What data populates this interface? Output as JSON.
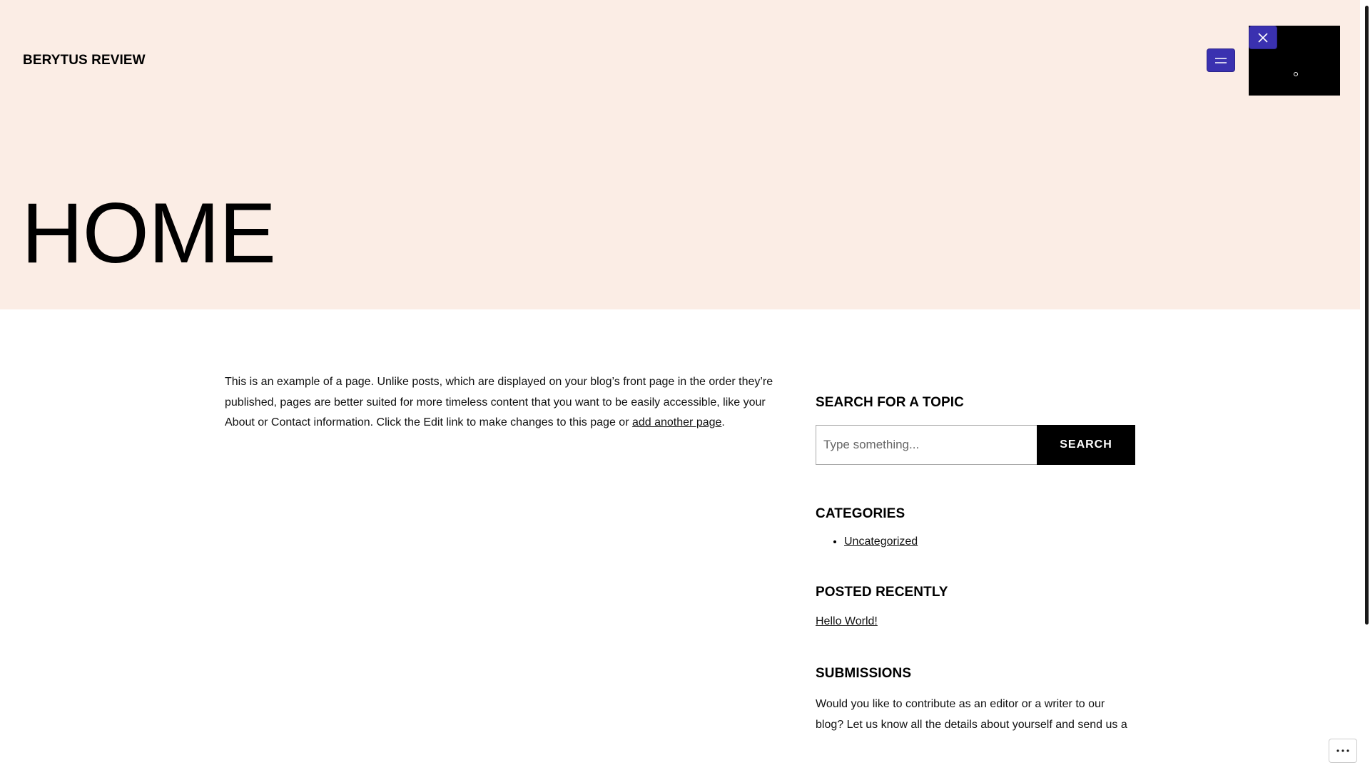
{
  "header": {
    "site_title": "BERYTUS REVIEW",
    "background": "#fbede5",
    "menu_icon": "hamburger-menu-icon",
    "close_icon": "close-icon",
    "accent": "#3a31b0"
  },
  "page": {
    "title": "HOME",
    "content_text": "This is an example of a page. Unlike posts, which are displayed on your blog’s front page in the order they’re published, pages are better suited for more timeless content that you want to be easily accessible, like your About or Contact information. Click the Edit link to make changes to this page or ",
    "content_link": "add another page",
    "content_end": "."
  },
  "sidebar": {
    "search_title": "SEARCH FOR A TOPIC",
    "search_placeholder": "Type something...",
    "search_button": "SEARCH",
    "categories_title": "CATEGORIES",
    "categories": [
      "Uncategorized"
    ],
    "recent_title": "POSTED RECENTLY",
    "recent_posts": [
      "Hello World!"
    ],
    "submissions_title": "SUBMISSIONS",
    "submissions_text": "Would you like to contribute as an editor or a writer to our blog? Let us know all the details about yourself and send us a"
  },
  "floating": {
    "more_icon": "more-options-icon"
  }
}
